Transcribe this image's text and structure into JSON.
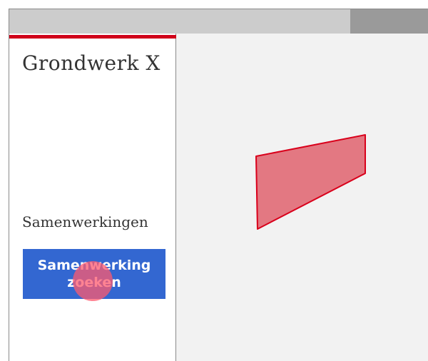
{
  "app": {
    "title": "Grondwerk X"
  },
  "sidebar": {
    "section_label": "Samenwerkingen",
    "search_button_label": "Samenwerking zoeken"
  },
  "colors": {
    "accent": "#d0001a",
    "button": "#3367d1",
    "highlight_shape_fill": "#e37882",
    "highlight_shape_stroke": "#d9001b",
    "click_indicator": "#ff5a6e"
  },
  "icons": {
    "selection_shape": "quadrilateral-highlight",
    "click_indicator": "touch-dot"
  }
}
